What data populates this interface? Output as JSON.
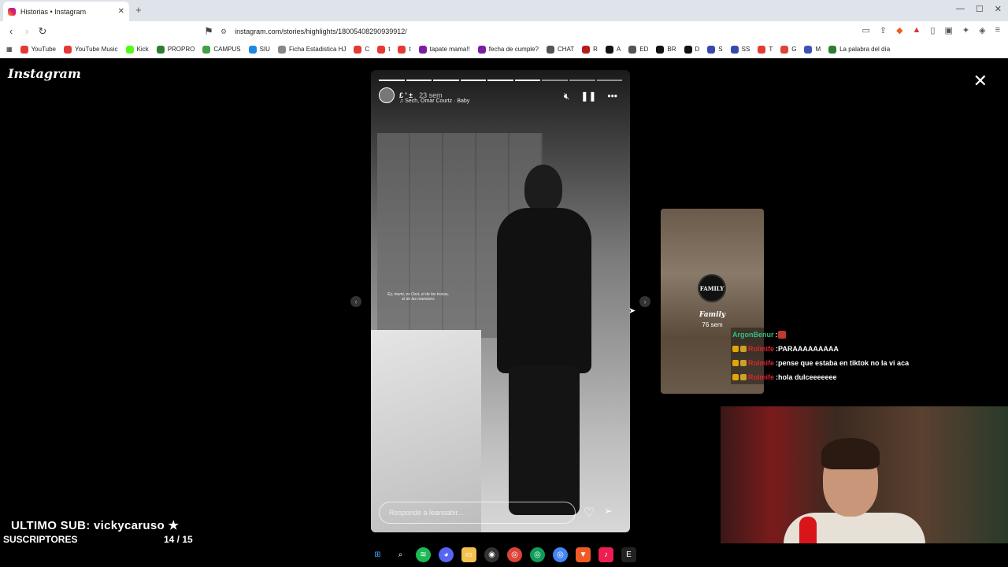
{
  "browser": {
    "tab_title": "Historias • Instagram",
    "url": "instagram.com/stories/highlights/18005408290939912/",
    "bookmarks": [
      "YouTube",
      "YouTube Music",
      "Kick",
      "PROPRO",
      "CAMPUS",
      "SIU",
      "Ficha Estadistica HJ",
      "C",
      "t",
      "t",
      "tapate mama!!",
      "fecha de cumple?",
      "CHAT",
      "R",
      "A",
      "ED",
      "BR",
      "D",
      "S",
      "SS",
      "T",
      "G",
      "M",
      "La palabra del día"
    ]
  },
  "instagram": {
    "logo": "Instagram",
    "story": {
      "user": "£ ' ±",
      "time": "23 sem",
      "song": "Sech, Omar Courtz · Baby",
      "caption": "Ey, mami, es Ozzi, el de las trocas, el de las mansions",
      "reply_placeholder": "Responde a leansabir...",
      "progress_segments": 9,
      "progress_done": 6
    },
    "next_preview": {
      "ring_text": "FAMILY",
      "name": "Family",
      "time": "76 sem"
    }
  },
  "chat": [
    {
      "user": "ArgonBenur",
      "text": "",
      "color": "green"
    },
    {
      "user": "Rolmife",
      "text": "PARAAAAAAAAA",
      "color": "red"
    },
    {
      "user": "Rolmife",
      "text": "pense que estaba en tiktok no la vi aca",
      "color": "red"
    },
    {
      "user": "Rolmife",
      "text": "hola dulceeeeeee",
      "color": "red"
    }
  ],
  "overlay": {
    "last_sub": "ULTIMO SUB: vickycaruso",
    "star": "★",
    "subs_label": "SUSCRIPTORES",
    "subs_count": "14   / 15",
    "subs_progress": 0.93
  }
}
